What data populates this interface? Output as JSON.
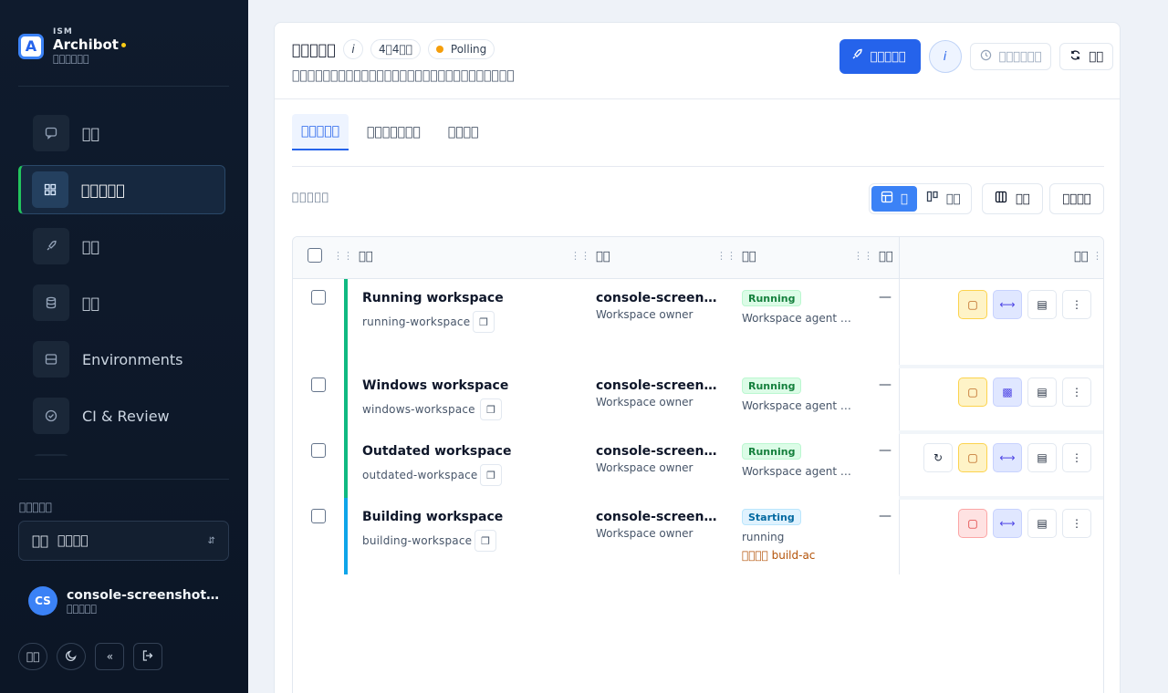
{
  "sidebar": {
    "brand_sup": "ISM",
    "brand_name": "Archibot",
    "brand_sub": "\u0000\u0000\u0000\u0000\u0000\u0000",
    "nav": [
      {
        "label": "\u0000\u0000",
        "icon": "chat-icon"
      },
      {
        "label": "\u0000\u0000\u0000\u0000\u0000",
        "icon": "grid-icon"
      },
      {
        "label": "\u0000\u0000",
        "icon": "rocket-icon"
      },
      {
        "label": "\u0000\u0000",
        "icon": "database-icon"
      },
      {
        "label": "Environments",
        "icon": "server-icon"
      },
      {
        "label": "CI & Review",
        "icon": "check-circle-icon"
      }
    ],
    "section_label": "\u0000\u0000\u0000\u0000\u0000",
    "select_icon": "\u0000\u0000",
    "select_value": "\u0000\u0000\u0000\u0000",
    "user_initials": "CS",
    "user_name": "console-screenshot-a...",
    "user_role": "\u0000\u0000\u0000\u0000\u0000",
    "lang_button": "\u0000\u0000"
  },
  "header": {
    "title": "\u0000\u0000\u0000\u0000\u0000",
    "info": "i",
    "count": "4\u00004\u0000\u0000",
    "polling": "Polling",
    "subtitle": "\u0000\u0000\u0000\u0000\u0000\u0000\u0000\u0000\u0000\u0000\u0000\u0000\u0000\u0000\u0000\u0000\u0000\u0000\u0000\u0000\u0000\u0000\u0000\u0000\u0000\u0000\u0000\u0000\u0000",
    "primary_label": "\u0000\u0000\u0000\u0000\u0000",
    "round_label": "i",
    "disabled_label": "\u0000\u0000\u0000\u0000\u0000\u0000",
    "refresh_label": "\u0000\u0000"
  },
  "tabs": [
    {
      "label": "\u0000\u0000\u0000\u0000\u0000",
      "active": true
    },
    {
      "label": "\u0000\u0000\u0000\u0000\u0000\u0000\u0000",
      "active": false
    },
    {
      "label": "\u0000\u0000\u0000\u0000",
      "active": false
    }
  ],
  "toolbar": {
    "label": "\u0000\u0000\u0000\u0000\u0000",
    "view_table": "\u0000",
    "view_board": "\u0000\u0000",
    "columns": "\u0000\u0000",
    "extra": "\u0000\u0000\u0000\u0000"
  },
  "table": {
    "columns": [
      "\u0000\u0000",
      "\u0000\u0000",
      "\u0000\u0000",
      "\u0000\u0000",
      "\u0000\u0000"
    ],
    "rows": [
      {
        "name": "Running workspace",
        "slug": "running-workspace",
        "owner": "console-screens...",
        "owner_role": "Workspace owner",
        "badge": "Running",
        "badge_color": "green",
        "status": "Workspace agent i...",
        "extra": "",
        "last": "—",
        "bar_color": "#10b981"
      },
      {
        "name": "Windows workspace",
        "slug": "windows-workspace",
        "owner": "console-screens...",
        "owner_role": "Workspace owner",
        "badge": "Running",
        "badge_color": "green",
        "status": "Workspace agent i...",
        "extra": "",
        "last": "—",
        "bar_color": "#10b981"
      },
      {
        "name": "Outdated workspace",
        "slug": "outdated-workspace",
        "owner": "console-screens...",
        "owner_role": "Workspace owner",
        "badge": "Running",
        "badge_color": "green",
        "status": "Workspace agent i...",
        "extra": "",
        "last": "—",
        "bar_color": "#10b981"
      },
      {
        "name": "Building workspace",
        "slug": "building-workspace",
        "owner": "console-screens...",
        "owner_role": "Workspace owner",
        "badge": "Starting",
        "badge_color": "blue",
        "status": "running",
        "extra": "\u0000\u0000\u0000\u0000 build-ac",
        "last": "—",
        "bar_color": "#0ea5e9"
      }
    ]
  }
}
